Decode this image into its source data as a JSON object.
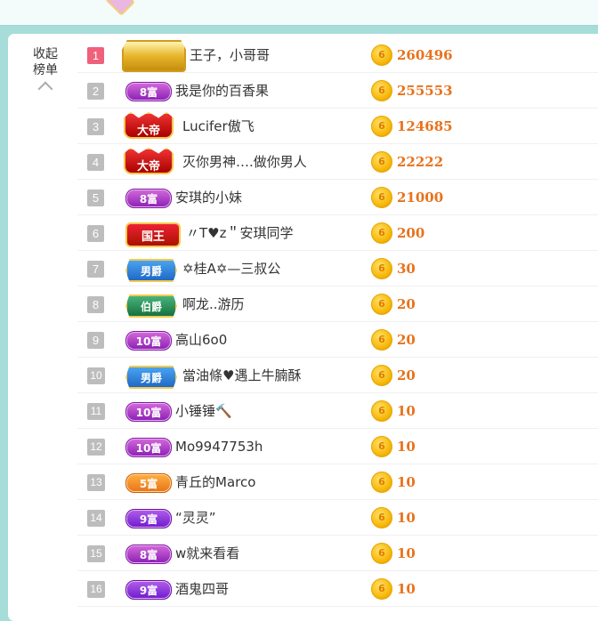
{
  "panel": {
    "collapse_line1": "收起",
    "collapse_line2": "榜单"
  },
  "colors": {
    "page_bg": "#a7ddd9",
    "amount": "#e8721c",
    "rank_first": "#f0607a",
    "rank_default": "#bdbdbd"
  },
  "rows": [
    {
      "rank": "1",
      "badge_type": "prince-crown",
      "badge_text": "",
      "name": "王子，小哥哥",
      "amount": "260496"
    },
    {
      "rank": "2",
      "badge_type": "rich",
      "badge_text": "8富",
      "name": "我是你的百香果",
      "amount": "255553"
    },
    {
      "rank": "3",
      "badge_type": "crown",
      "badge_text": "大帝",
      "name": "Lucifer傲飞",
      "amount": "124685"
    },
    {
      "rank": "4",
      "badge_type": "crown",
      "badge_text": "大帝",
      "name": "灭你男神….做你男人",
      "amount": "22222"
    },
    {
      "rank": "5",
      "badge_type": "rich",
      "badge_text": "8富",
      "name": "安琪的小妹",
      "amount": "21000"
    },
    {
      "rank": "6",
      "badge_type": "king",
      "badge_text": "国王",
      "name": "〃T♥z＂安琪同学",
      "amount": "200"
    },
    {
      "rank": "7",
      "badge_type": "noble-blue",
      "badge_text": "男爵",
      "name": "✡桂A✡—三叔公",
      "amount": "30"
    },
    {
      "rank": "8",
      "badge_type": "noble-green",
      "badge_text": "伯爵",
      "name": "啊龙..游历",
      "amount": "20"
    },
    {
      "rank": "9",
      "badge_type": "rich",
      "badge_text": "10富",
      "name": "高山6o0",
      "amount": "20"
    },
    {
      "rank": "10",
      "badge_type": "noble-blue",
      "badge_text": "男爵",
      "name": "當油條♥遇上牛腩酥",
      "amount": "20"
    },
    {
      "rank": "11",
      "badge_type": "rich",
      "badge_text": "10富",
      "name": "小锤锤🔨",
      "amount": "10"
    },
    {
      "rank": "12",
      "badge_type": "rich",
      "badge_text": "10富",
      "name": "Mo9947753h",
      "amount": "10"
    },
    {
      "rank": "13",
      "badge_type": "rich-orange",
      "badge_text": "5富",
      "name": "青丘的Marco",
      "amount": "10"
    },
    {
      "rank": "14",
      "badge_type": "rich-purple",
      "badge_text": "9富",
      "name": "“灵灵”",
      "amount": "10"
    },
    {
      "rank": "15",
      "badge_type": "rich",
      "badge_text": "8富",
      "name": "w就来看看",
      "amount": "10"
    },
    {
      "rank": "16",
      "badge_type": "rich-purple",
      "badge_text": "9富",
      "name": "酒鬼四哥",
      "amount": "10"
    }
  ]
}
